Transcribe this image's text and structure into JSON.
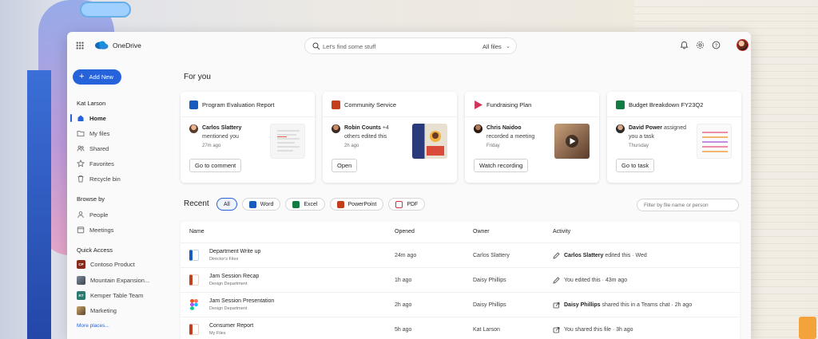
{
  "app": {
    "name": "OneDrive"
  },
  "search": {
    "placeholder": "Let's find some stuff",
    "scope": "All files"
  },
  "sidebar": {
    "new_label": "Add New",
    "user_name": "Kat Larson",
    "nav": [
      {
        "label": "Home",
        "icon": "home-icon"
      },
      {
        "label": "My files",
        "icon": "folder-icon"
      },
      {
        "label": "Shared",
        "icon": "people-icon"
      },
      {
        "label": "Favorites",
        "icon": "star-icon"
      },
      {
        "label": "Recycle bin",
        "icon": "trash-icon"
      }
    ],
    "browse_heading": "Browse by",
    "browse": [
      {
        "label": "People",
        "icon": "person-icon"
      },
      {
        "label": "Meetings",
        "icon": "calendar-icon"
      }
    ],
    "quick_heading": "Quick Access",
    "quick": [
      {
        "label": "Contoso Product",
        "badge": "CP",
        "color": "#8a2a1a"
      },
      {
        "label": "Mountain Expansion...",
        "badge": "",
        "color": "#4a4a4a"
      },
      {
        "label": "Kemper Table Team",
        "badge": "KT",
        "color": "#2c7a6e"
      },
      {
        "label": "Marketing",
        "badge": "",
        "color": "#6a5a3a"
      }
    ],
    "more_label": "More places..."
  },
  "for_you": {
    "heading": "For you",
    "cards": [
      {
        "title": "Program Evaluation Report",
        "app": "word",
        "color": "#185abd",
        "person": "Carlos Slattery",
        "rest1": "",
        "line2": "mentioned you",
        "time": "27m ago",
        "action": "Go to comment"
      },
      {
        "title": "Community Service",
        "app": "powerpoint",
        "color": "#c43e1c",
        "person": "Robin Counts",
        "rest1": " +4",
        "line2": "others edited this",
        "time": "2h ago",
        "action": "Open"
      },
      {
        "title": "Fundraising Plan",
        "app": "stream",
        "color": "#d1345b",
        "person": "Chris Naidoo",
        "rest1": "",
        "line2": "recorded a meeting",
        "time": "Friday",
        "action": "Watch recording"
      },
      {
        "title": "Budget Breakdown FY23Q2",
        "app": "excel",
        "color": "#107c41",
        "person": "David Power",
        "rest1": " assigned",
        "line2": "you a task",
        "time": "Thursday",
        "action": "Go to task"
      }
    ]
  },
  "recent": {
    "heading": "Recent",
    "filters": [
      {
        "label": "All",
        "color": ""
      },
      {
        "label": "Word",
        "color": "#185abd"
      },
      {
        "label": "Excel",
        "color": "#107c41"
      },
      {
        "label": "PowerPoint",
        "color": "#c43e1c"
      },
      {
        "label": "PDF",
        "color": "#d13438"
      }
    ],
    "filter_placeholder": "Filter by file name or person",
    "columns": {
      "name": "Name",
      "opened": "Opened",
      "owner": "Owner",
      "activity": "Activity"
    },
    "rows": [
      {
        "name": "Department Write up",
        "location": "Director's Files",
        "opened": "24m ago",
        "owner": "Carlos Slattery",
        "actor": "Carlos Slattery",
        "activity": " edited this · Wed",
        "file_color": "#185abd",
        "activity_icon": "pencil-icon"
      },
      {
        "name": "Jam Session Recap",
        "location": "Design Department",
        "opened": "1h ago",
        "owner": "Daisy Phillips",
        "actor": "",
        "activity": "You edited this · 43m ago",
        "file_color": "#c43e1c",
        "activity_icon": "pencil-icon"
      },
      {
        "name": "Jam Session Presentation",
        "location": "Design Department",
        "opened": "2h ago",
        "owner": "Daisy Phillips",
        "actor": "Daisy Phillips",
        "activity": " shared this in a Teams chat · 2h ago",
        "file_color": "#a259ff",
        "activity_icon": "share-icon"
      },
      {
        "name": "Consumer Report",
        "location": "My Files",
        "opened": "5h ago",
        "owner": "Kat Larson",
        "actor": "",
        "activity": "You shared this file · 3h ago",
        "file_color": "#c43e1c",
        "activity_icon": "share-icon"
      }
    ]
  }
}
